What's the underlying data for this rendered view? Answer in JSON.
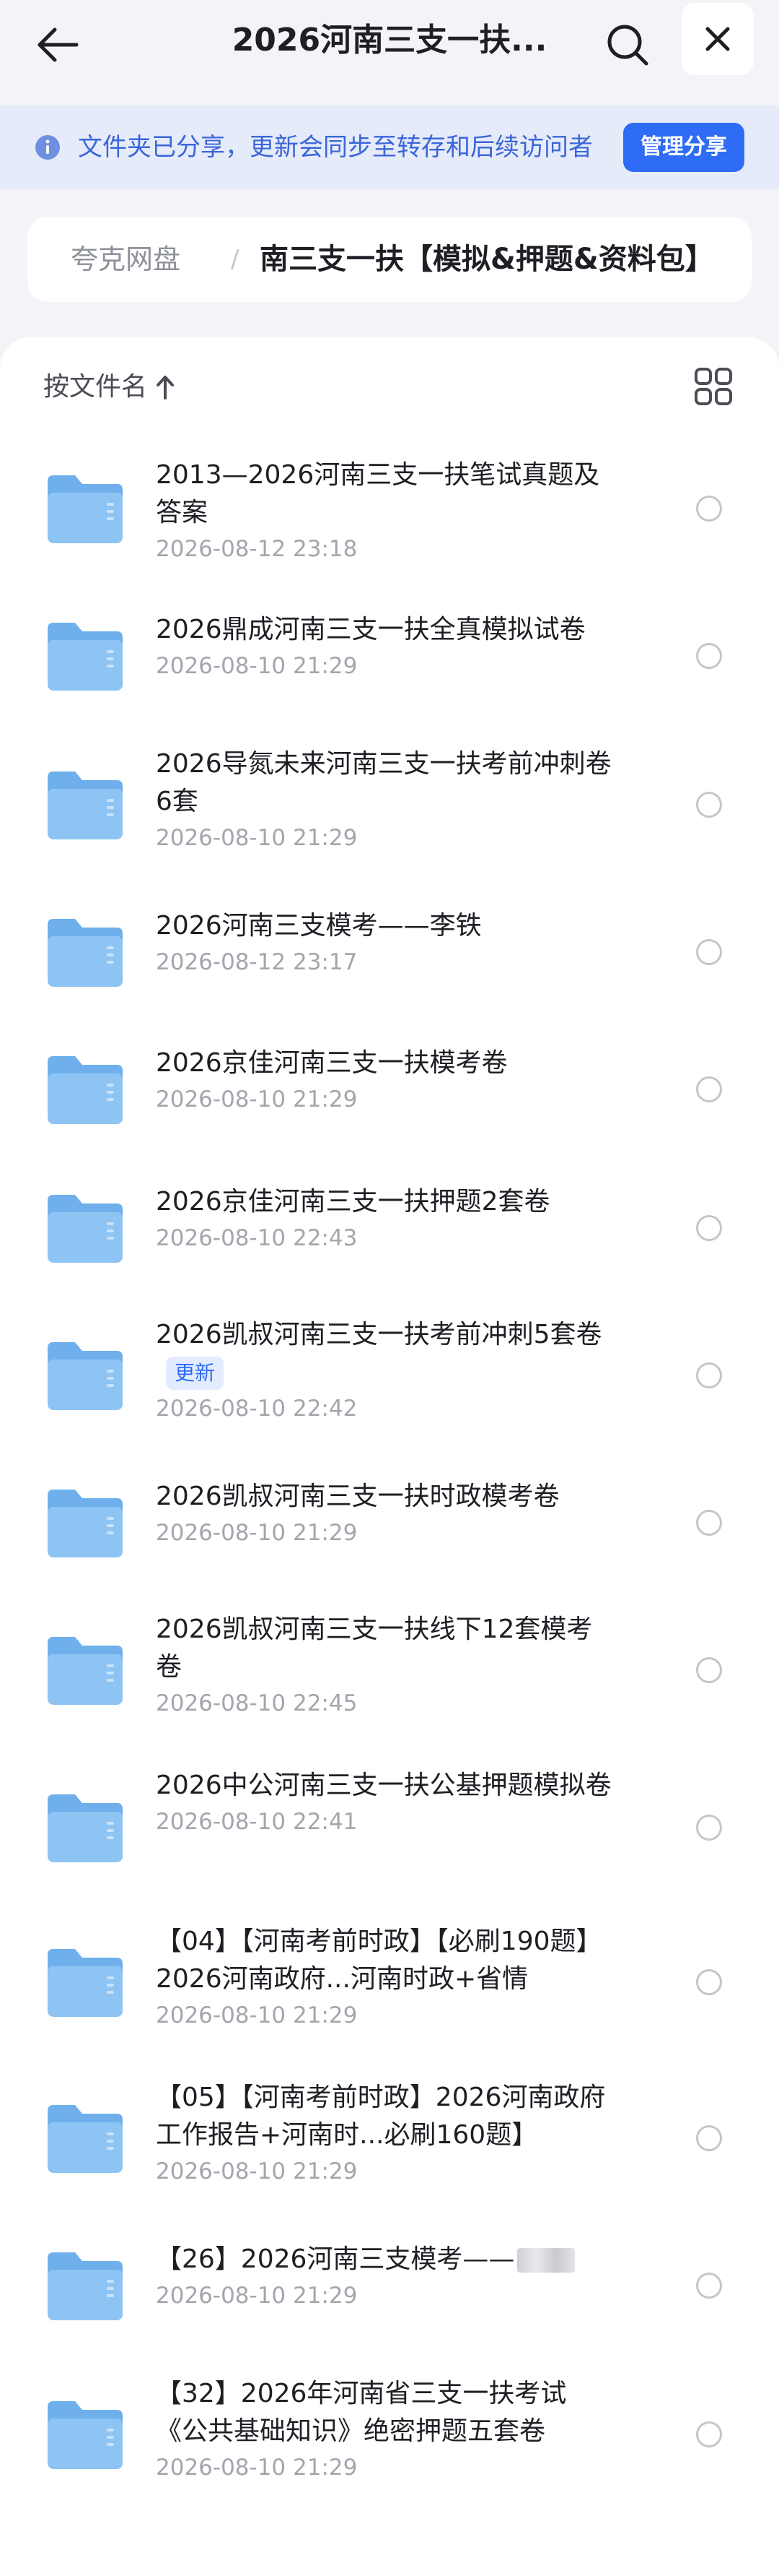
{
  "header": {
    "title": "2026河南三支一扶...",
    "back_icon": "arrow-left-icon",
    "search_icon": "search-icon",
    "close_icon": "close-icon"
  },
  "notice": {
    "text": "文件夹已分享，更新会同步至转存和后续访问者",
    "manage_label": "管理分享",
    "icon": "info-icon"
  },
  "breadcrumb": {
    "root": "夸克网盘",
    "separator": "/",
    "current": "南三支一扶【模拟&押题&资料包】"
  },
  "list_header": {
    "sort_label": "按文件名",
    "sort_icon": "arrow-up-icon",
    "view_icon": "grid-view-icon"
  },
  "colors": {
    "accent": "#2f6cf6",
    "notice_bg": "#e6ebfa",
    "folder": "#8ec4f3"
  },
  "files": [
    {
      "name": "2013—2026河南三支一扶笔试真题及答案",
      "date": "2026-08-12 23:18"
    },
    {
      "name": "2026鼎成河南三支一扶全真模拟试卷",
      "date": "2026-08-10 21:29"
    },
    {
      "name": "2026导氮未来河南三支一扶考前冲刺卷6套",
      "date": "2026-08-10 21:29"
    },
    {
      "name": "2026河南三支模考——李铁",
      "date": "2026-08-12 23:17"
    },
    {
      "name": "2026京佳河南三支一扶模考卷",
      "date": "2026-08-10 21:29"
    },
    {
      "name": "2026京佳河南三支一扶押题2套卷",
      "date": "2026-08-10 22:43"
    },
    {
      "name": "2026凯叔河南三支一扶考前冲刺5套卷",
      "date": "2026-08-10 22:42",
      "badge": "更新"
    },
    {
      "name": "2026凯叔河南三支一扶时政模考卷",
      "date": "2026-08-10 21:29"
    },
    {
      "name": "2026凯叔河南三支一扶线下12套模考卷",
      "date": "2026-08-10 22:45"
    },
    {
      "name": "2026中公河南三支一扶公基押题模拟卷",
      "date": "2026-08-10 22:41"
    },
    {
      "name": "【04】【河南考前时政】【必刷190题】2026河南政府...河南时政+省情",
      "date": "2026-08-10 21:29"
    },
    {
      "name": "【05】【河南考前时政】2026河南政府工作报告+河南时...必刷160题】",
      "date": "2026-08-10 21:29"
    },
    {
      "name": "【26】2026河南三支模考——",
      "date": "2026-08-10 21:29"
    },
    {
      "name": "【32】2026年河南省三支一扶考试《公共基础知识》绝密押题五套卷",
      "date": "2026-08-10 21:29"
    }
  ]
}
